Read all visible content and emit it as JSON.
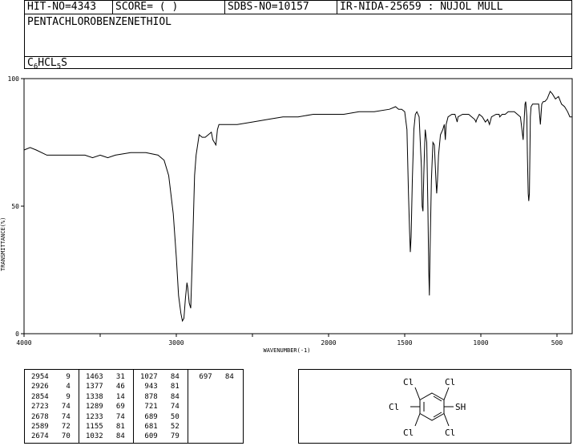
{
  "header": {
    "hit_no": "HIT-NO=4343",
    "score": "SCORE=  (   )",
    "sdbs_no": "SDBS-NO=10157",
    "ir_info": "IR-NIDA-25659 : NUJOL MULL",
    "compound_name": "PENTACHLOROBENZENETHIOL",
    "formula": {
      "c": "C",
      "c_n": "6",
      "hcl": "HCL",
      "cl_n": "5",
      "s": "S"
    }
  },
  "chart_data": {
    "type": "line",
    "title": "",
    "xlabel": "WAVENUMBER(-1)",
    "ylabel": "TRANSMITTANCE(%)",
    "x_ticks": [
      "4000",
      "3000",
      "2000",
      "1500",
      "1000",
      "500"
    ],
    "y_ticks": [
      "100",
      "50",
      "0"
    ],
    "xlim": [
      4000,
      400
    ],
    "ylim": [
      0,
      100
    ],
    "grid": false,
    "series": [
      {
        "points": [
          [
            4000,
            72
          ],
          [
            3960,
            73
          ],
          [
            3920,
            72
          ],
          [
            3850,
            70
          ],
          [
            3800,
            70
          ],
          [
            3700,
            70
          ],
          [
            3600,
            70
          ],
          [
            3550,
            69
          ],
          [
            3500,
            70
          ],
          [
            3450,
            69
          ],
          [
            3400,
            70
          ],
          [
            3300,
            71
          ],
          [
            3200,
            71
          ],
          [
            3120,
            70
          ],
          [
            3080,
            68
          ],
          [
            3050,
            62
          ],
          [
            3020,
            47
          ],
          [
            3000,
            30
          ],
          [
            2985,
            15
          ],
          [
            2970,
            8
          ],
          [
            2960,
            5
          ],
          [
            2950,
            6
          ],
          [
            2940,
            14
          ],
          [
            2930,
            20
          ],
          [
            2925,
            18
          ],
          [
            2915,
            12
          ],
          [
            2905,
            10
          ],
          [
            2895,
            30
          ],
          [
            2880,
            62
          ],
          [
            2870,
            70
          ],
          [
            2860,
            74
          ],
          [
            2850,
            78
          ],
          [
            2830,
            77
          ],
          [
            2810,
            77
          ],
          [
            2790,
            78
          ],
          [
            2770,
            79
          ],
          [
            2760,
            76
          ],
          [
            2740,
            74
          ],
          [
            2730,
            80
          ],
          [
            2720,
            82
          ],
          [
            2700,
            82
          ],
          [
            2650,
            82
          ],
          [
            2600,
            82
          ],
          [
            2500,
            83
          ],
          [
            2400,
            84
          ],
          [
            2300,
            85
          ],
          [
            2200,
            85
          ],
          [
            2100,
            86
          ],
          [
            2000,
            86
          ],
          [
            1900,
            86
          ],
          [
            1800,
            87
          ],
          [
            1700,
            87
          ],
          [
            1600,
            88
          ],
          [
            1560,
            89
          ],
          [
            1540,
            88
          ],
          [
            1520,
            88
          ],
          [
            1500,
            87
          ],
          [
            1485,
            80
          ],
          [
            1475,
            55
          ],
          [
            1468,
            40
          ],
          [
            1463,
            32
          ],
          [
            1458,
            38
          ],
          [
            1450,
            60
          ],
          [
            1440,
            80
          ],
          [
            1430,
            86
          ],
          [
            1420,
            87
          ],
          [
            1405,
            85
          ],
          [
            1390,
            65
          ],
          [
            1385,
            50
          ],
          [
            1380,
            48
          ],
          [
            1375,
            62
          ],
          [
            1370,
            72
          ],
          [
            1365,
            80
          ],
          [
            1355,
            75
          ],
          [
            1348,
            50
          ],
          [
            1342,
            25
          ],
          [
            1338,
            15
          ],
          [
            1334,
            30
          ],
          [
            1325,
            60
          ],
          [
            1315,
            75
          ],
          [
            1305,
            74
          ],
          [
            1295,
            60
          ],
          [
            1290,
            55
          ],
          [
            1285,
            60
          ],
          [
            1278,
            70
          ],
          [
            1265,
            78
          ],
          [
            1250,
            80
          ],
          [
            1240,
            82
          ],
          [
            1233,
            76
          ],
          [
            1228,
            82
          ],
          [
            1215,
            85
          ],
          [
            1190,
            86
          ],
          [
            1170,
            86
          ],
          [
            1155,
            83
          ],
          [
            1150,
            85
          ],
          [
            1120,
            86
          ],
          [
            1100,
            86
          ],
          [
            1080,
            86
          ],
          [
            1060,
            85
          ],
          [
            1040,
            84
          ],
          [
            1032,
            83
          ],
          [
            1027,
            84
          ],
          [
            1010,
            86
          ],
          [
            990,
            85
          ],
          [
            970,
            83
          ],
          [
            955,
            84
          ],
          [
            943,
            82
          ],
          [
            930,
            85
          ],
          [
            900,
            86
          ],
          [
            880,
            86
          ],
          [
            876,
            85
          ],
          [
            860,
            86
          ],
          [
            840,
            86
          ],
          [
            820,
            87
          ],
          [
            800,
            87
          ],
          [
            780,
            87
          ],
          [
            760,
            86
          ],
          [
            740,
            85
          ],
          [
            730,
            80
          ],
          [
            722,
            76
          ],
          [
            715,
            84
          ],
          [
            710,
            90
          ],
          [
            705,
            91
          ],
          [
            698,
            85
          ],
          [
            694,
            70
          ],
          [
            689,
            55
          ],
          [
            685,
            52
          ],
          [
            681,
            55
          ],
          [
            675,
            85
          ],
          [
            670,
            89
          ],
          [
            660,
            90
          ],
          [
            640,
            90
          ],
          [
            620,
            90
          ],
          [
            609,
            82
          ],
          [
            600,
            90
          ],
          [
            590,
            91
          ],
          [
            580,
            91
          ],
          [
            565,
            92
          ],
          [
            545,
            95
          ],
          [
            530,
            94
          ],
          [
            510,
            92
          ],
          [
            490,
            93
          ],
          [
            470,
            90
          ],
          [
            450,
            89
          ],
          [
            430,
            87
          ],
          [
            415,
            85
          ],
          [
            400,
            85
          ]
        ]
      }
    ]
  },
  "peak_table": {
    "columns": [
      [
        "2954    9",
        "2926    4",
        "2854    9",
        "2723   74",
        "2678   74",
        "2589   72",
        "2674   70"
      ],
      [
        "1463   31",
        "1377   46",
        "1338   14",
        "1289   69",
        "1233   74",
        "1155   81",
        "1032   84"
      ],
      [
        "1027   84",
        " 943   81",
        " 878   84",
        " 721   74",
        " 689   50",
        " 681   52",
        " 609   79"
      ],
      [
        " 697   84"
      ]
    ]
  },
  "structure": {
    "cl_top_left": "Cl",
    "cl_top_right": "Cl",
    "cl_left": "Cl",
    "sh": "SH",
    "cl_bottom_left": "Cl",
    "cl_bottom_right": "Cl"
  }
}
